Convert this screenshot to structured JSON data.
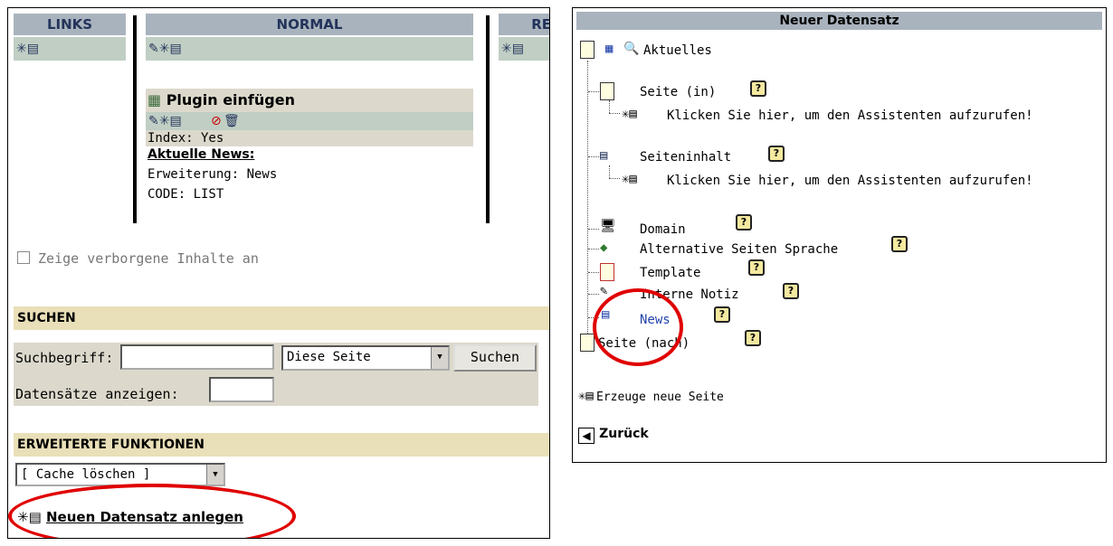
{
  "left": {
    "columns": {
      "links": "LINKS",
      "normal": "NORMAL",
      "right_partial": "RE"
    },
    "plugin": {
      "title": "Plugin einfügen",
      "index": "Index: Yes",
      "news_heading": "Aktuelle News:",
      "extension": "Erweiterung: News",
      "code": "CODE: LIST"
    },
    "show_hidden": "Zeige verborgene Inhalte an",
    "search": {
      "section": "SUCHEN",
      "term_label": "Suchbegriff:",
      "scope": "Diese Seite",
      "button": "Suchen",
      "records_label": "Datensätze anzeigen:"
    },
    "advanced": {
      "section": "ERWEITERTE FUNKTIONEN",
      "select": "[ Cache löschen ]",
      "new_record": "Neuen Datensatz anlegen"
    }
  },
  "right": {
    "title": "Neuer Datensatz",
    "root": "Aktuelles",
    "page_in": "Seite (in)",
    "wizard1": "Klicken Sie hier, um den Assistenten aufzurufen!",
    "content": "Seiteninhalt",
    "wizard2": "Klicken Sie hier, um den Assistenten aufzurufen!",
    "domain": "Domain",
    "alt_lang": "Alternative Seiten Sprache",
    "template": "Template",
    "note": "Interne Notiz",
    "news": "News",
    "page_after": "Seite (nach)",
    "create_page": "Erzeuge neue Seite",
    "back": "Zurück",
    "help_glyph": "?"
  },
  "colors": {
    "header_gray": "#a9b3bd",
    "bar_green": "#c0cec4",
    "section_beige": "#e9dfb8",
    "highlight_red": "#e00000",
    "news_blue": "#2244aa"
  }
}
